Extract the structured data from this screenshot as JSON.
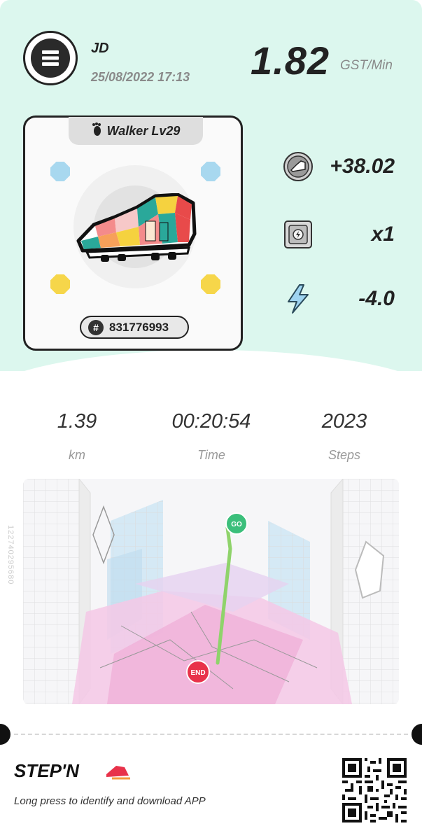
{
  "header": {
    "username": "JD",
    "datetime": "25/08/2022 17:13",
    "rate_value": "1.82",
    "rate_unit": "GST/Min"
  },
  "sneaker": {
    "level_label": "Walker Lv29",
    "id": "831776993"
  },
  "stats": [
    {
      "icon": "sneaker-coin-icon",
      "value": "+38.02"
    },
    {
      "icon": "mystery-box-icon",
      "value": "x1"
    },
    {
      "icon": "energy-bolt-icon",
      "value": "-4.0"
    }
  ],
  "metrics": [
    {
      "value": "1.39",
      "label": "km"
    },
    {
      "value": "00:20:54",
      "label": "Time"
    },
    {
      "value": "2023",
      "label": "Steps"
    }
  ],
  "map": {
    "start_label": "GO",
    "end_label": "END",
    "side_id": "122740295680"
  },
  "footer": {
    "brand": "STEP'N",
    "text": "Long press to identify and download APP"
  },
  "colors": {
    "top_background": "#dcf7ee",
    "go_marker": "#3bbf7b",
    "end_marker": "#e8324a",
    "route_line": "#8fd36b"
  }
}
